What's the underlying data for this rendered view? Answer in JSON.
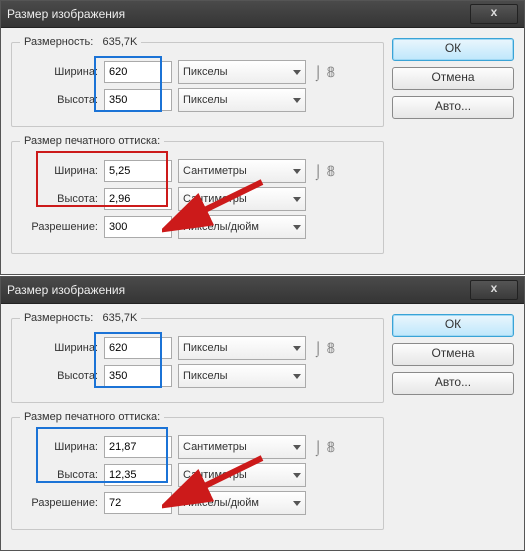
{
  "window1": {
    "title": "Размер изображения",
    "close_x": "x",
    "ok": "ОК",
    "cancel": "Отмена",
    "auto": "Авто...",
    "dim": {
      "legend": "Размерность:",
      "filesize": "635,7K",
      "width_label": "Ширина:",
      "width_value": "620",
      "width_unit": "Пикселы",
      "height_label": "Высота:",
      "height_value": "350",
      "height_unit": "Пикселы"
    },
    "print": {
      "legend": "Размер печатного оттиска:",
      "width_label": "Ширина:",
      "width_value": "5,25",
      "width_unit": "Сантиметры",
      "height_label": "Высота:",
      "height_value": "2,96",
      "height_unit": "Сантиметры",
      "res_label": "Разрешение:",
      "res_value": "300",
      "res_unit": "Пикселы/дюйм"
    },
    "link_glyph": "⌡ 𝟠"
  },
  "window2": {
    "title": "Размер изображения",
    "close_x": "x",
    "ok": "ОК",
    "cancel": "Отмена",
    "auto": "Авто...",
    "dim": {
      "legend": "Размерность:",
      "filesize": "635,7K",
      "width_label": "Ширина:",
      "width_value": "620",
      "width_unit": "Пикселы",
      "height_label": "Высота:",
      "height_value": "350",
      "height_unit": "Пикселы"
    },
    "print": {
      "legend": "Размер печатного оттиска:",
      "width_label": "Ширина:",
      "width_value": "21,87",
      "width_unit": "Сантиметры",
      "height_label": "Высота:",
      "height_value": "12,35",
      "height_unit": "Сантиметры",
      "res_label": "Разрешение:",
      "res_value": "72",
      "res_unit": "Пикселы/дюйм"
    },
    "link_glyph": "⌡ 𝟠"
  }
}
